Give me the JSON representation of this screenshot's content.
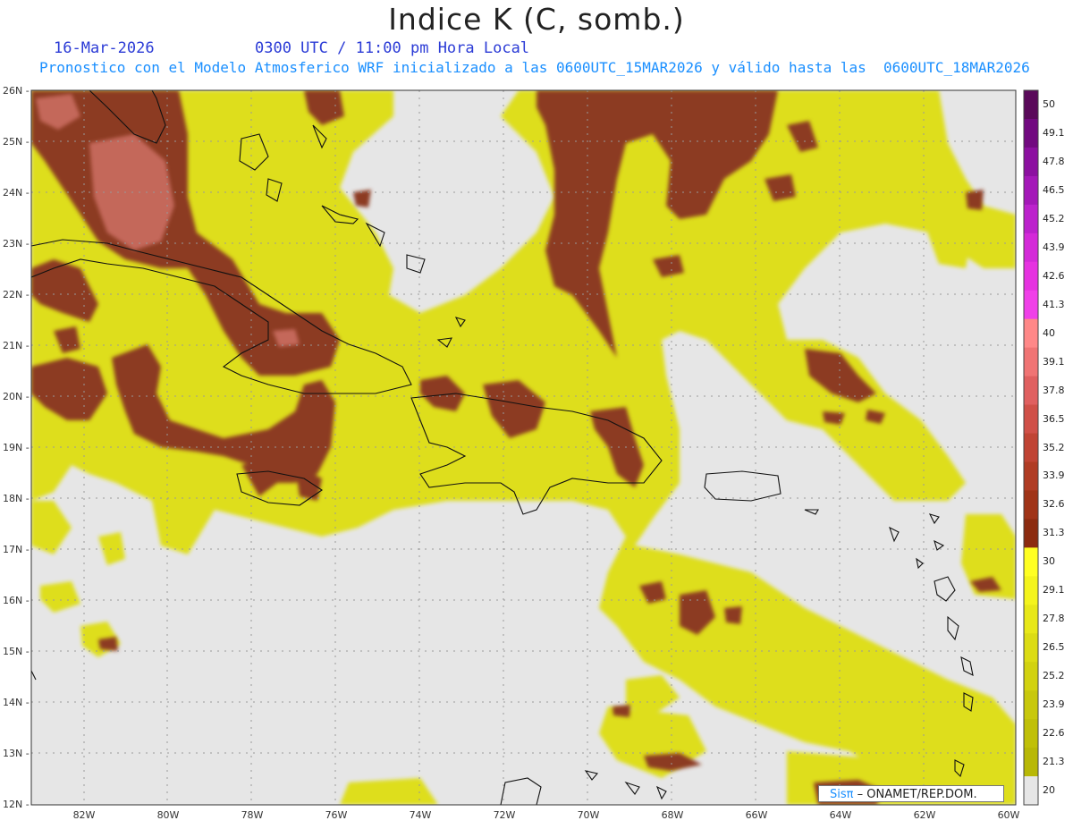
{
  "header": {
    "title": "Indice K (C, somb.)",
    "date": "16-Mar-2026",
    "time": "0300 UTC / 11:00 pm Hora Local",
    "forecast": "Pronostico con el Modelo Atmosferico WRF inicializado a las 0600UTC_15MAR2026 y válido hasta las  0600UTC_18MAR2026"
  },
  "axes": {
    "lat_labels": [
      "26N",
      "25N",
      "24N",
      "23N",
      "22N",
      "21N",
      "20N",
      "19N",
      "18N",
      "17N",
      "16N",
      "15N",
      "14N",
      "13N",
      "12N"
    ],
    "lon_labels": [
      "82W",
      "80W",
      "78W",
      "76W",
      "74W",
      "72W",
      "70W",
      "68W",
      "66W",
      "64W",
      "62W",
      "60W"
    ]
  },
  "colorbar": {
    "labels": [
      "50",
      "49.1",
      "47.8",
      "46.5",
      "45.2",
      "43.9",
      "42.6",
      "41.3",
      "40",
      "39.1",
      "37.8",
      "36.5",
      "35.2",
      "33.9",
      "32.6",
      "31.3",
      "30",
      "29.1",
      "27.8",
      "26.5",
      "25.2",
      "23.9",
      "22.6",
      "21.3",
      "20"
    ],
    "colors": [
      "#5a0a5a",
      "#720a80",
      "#8c10a0",
      "#a418b8",
      "#bc22cc",
      "#d42ad8",
      "#e632e0",
      "#f040e8",
      "#ff8888",
      "#f07474",
      "#e06060",
      "#d05048",
      "#c04434",
      "#b03c24",
      "#a03418",
      "#8c2c10",
      "#ffff22",
      "#f4f41c",
      "#e8e818",
      "#dcdc14",
      "#d2d210",
      "#c8c80c",
      "#c0c008",
      "#b8b806",
      "#e6e6e6"
    ]
  },
  "credit": {
    "brand": "Sisπ",
    "org": " – ONAMET/REP.DOM."
  },
  "colors": {
    "ocean": "#e6e6e6",
    "k20_30": "#e0e01a",
    "k30_40": "#8e3a26",
    "k40_high": "#c26a58"
  }
}
